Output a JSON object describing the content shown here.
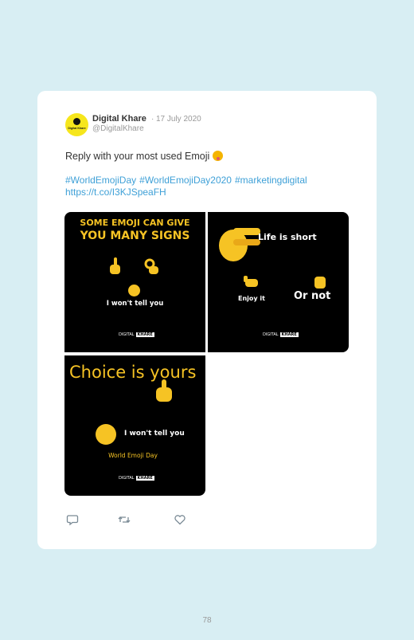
{
  "tweet": {
    "avatar_logo_text": "Digital Khare",
    "user_name": "Digital Khare",
    "separator": "·",
    "date": "17 July 2020",
    "handle": "@DigitalKhare",
    "text": "Reply with your most used Emoji",
    "hashtags": [
      "#WorldEmojiDay",
      "#WorldEmojiDay2020",
      "#marketingdigital"
    ],
    "link": "https://t.co/I3KJSpeaFH"
  },
  "media": {
    "panel1": {
      "heading_line1": "SOME EMOJI CAN GIVE",
      "heading_line2": "YOU MANY SIGNS",
      "caption": "I won't tell you",
      "brand_left": "DIGITAL",
      "brand_right": "KHARE"
    },
    "panel2": {
      "heading": "Life is short",
      "left_caption": "Enjoy it",
      "right_caption": "Or not",
      "brand_left": "DIGITAL",
      "brand_right": "KHARE"
    },
    "panel3": {
      "heading": "Choice is yours",
      "caption": "I won't tell you",
      "subcaption": "World Emoji Day",
      "brand_left": "DIGITAL",
      "brand_right": "KHARE"
    }
  },
  "actions": {
    "reply_icon": "reply-icon",
    "retweet_icon": "retweet-icon",
    "like_icon": "heart-icon"
  },
  "page_number": "78",
  "colors": {
    "page_bg": "#d8eef3",
    "link": "#3ea0d7",
    "yellow": "#f6c324"
  }
}
